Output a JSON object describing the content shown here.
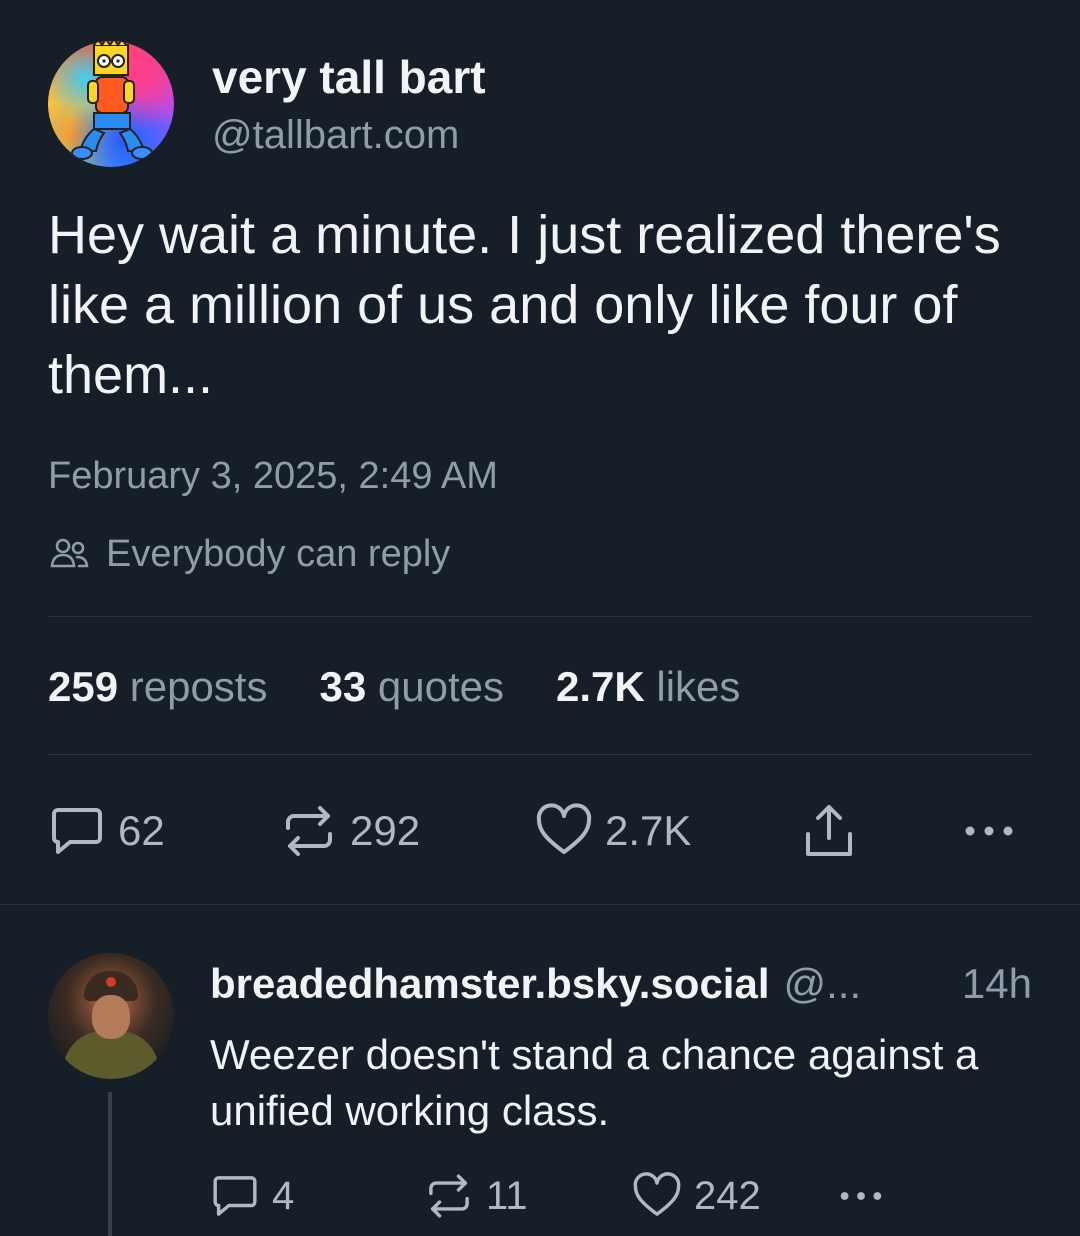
{
  "post": {
    "author": {
      "display_name": "very tall bart",
      "handle": "@tallbart.com"
    },
    "text": "Hey wait a minute. I just realized there's like a million of us and only like four of them...",
    "timestamp": "February 3, 2025, 2:49 AM",
    "reply_setting": "Everybody can reply",
    "stats": {
      "reposts_count": "259",
      "reposts_label": "reposts",
      "quotes_count": "33",
      "quotes_label": "quotes",
      "likes_count": "2.7K",
      "likes_label": "likes"
    },
    "actions": {
      "reply_count": "62",
      "repost_count": "292",
      "like_count": "2.7K"
    }
  },
  "reply": {
    "author": {
      "display_name": "breadedhamster.bsky.social",
      "handle": "@..."
    },
    "time": "14h",
    "text": "Weezer doesn't stand a chance against a unified working class.",
    "actions": {
      "reply_count": "4",
      "repost_count": "11",
      "like_count": "242"
    }
  },
  "icons": {
    "reply_setting": "people-icon",
    "reply": "comment-bubble-icon",
    "repost": "repost-arrows-icon",
    "like": "heart-icon",
    "share": "share-upload-icon",
    "more": "more-dots-icon"
  },
  "colors": {
    "background": "#161e27",
    "text_primary": "#f1f3f5",
    "text_secondary": "#8e9cab",
    "divider": "#2b3642"
  }
}
